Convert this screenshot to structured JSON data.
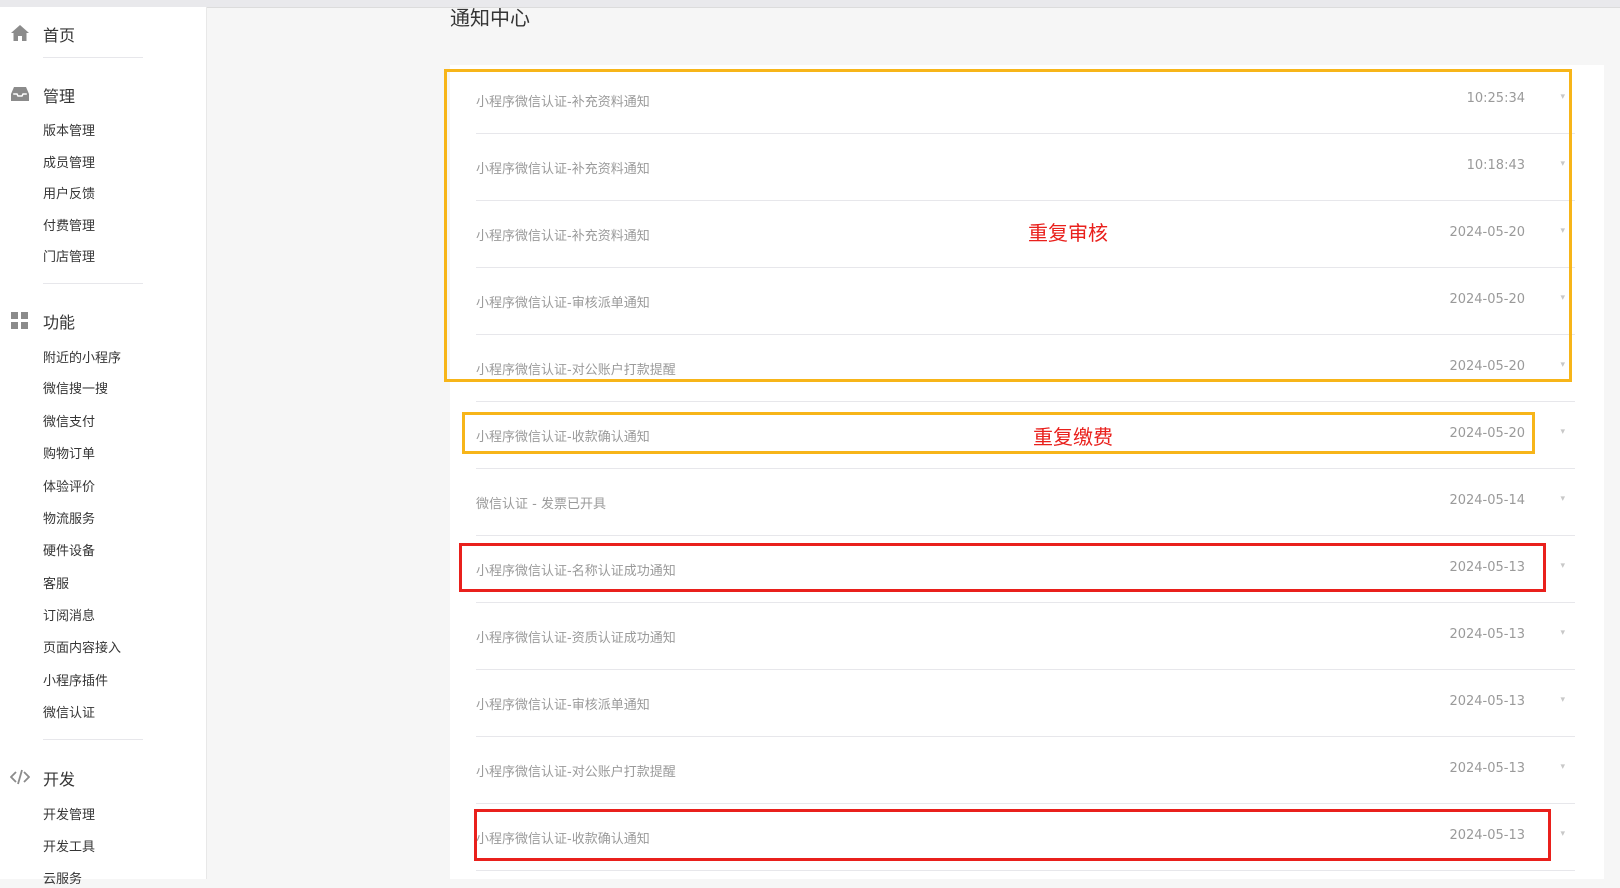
{
  "sidebar": {
    "home": {
      "label": "首页",
      "icon": "home-icon"
    },
    "manage": {
      "label": "管理",
      "icon": "inbox-icon",
      "items": [
        "版本管理",
        "成员管理",
        "用户反馈",
        "付费管理",
        "门店管理"
      ]
    },
    "features": {
      "label": "功能",
      "icon": "grid-icon",
      "items": [
        "附近的小程序",
        "微信搜一搜",
        "微信支付",
        "购物订单",
        "体验评价",
        "物流服务",
        "硬件设备",
        "客服",
        "订阅消息",
        "页面内容接入",
        "小程序插件",
        "微信认证"
      ]
    },
    "develop": {
      "label": "开发",
      "icon": "code-icon",
      "items": [
        "开发管理",
        "开发工具",
        "云服务"
      ]
    }
  },
  "main": {
    "title": "通知中心",
    "notifications": [
      {
        "title": "小程序微信认证-补充资料通知",
        "time": "10:25:34"
      },
      {
        "title": "小程序微信认证-补充资料通知",
        "time": "10:18:43"
      },
      {
        "title": "小程序微信认证-补充资料通知",
        "time": "2024-05-20"
      },
      {
        "title": "小程序微信认证-审核派单通知",
        "time": "2024-05-20"
      },
      {
        "title": "小程序微信认证-对公账户打款提醒",
        "time": "2024-05-20"
      },
      {
        "title": "小程序微信认证-收款确认通知",
        "time": "2024-05-20"
      },
      {
        "title": "微信认证 - 发票已开具",
        "time": "2024-05-14"
      },
      {
        "title": "小程序微信认证-名称认证成功通知",
        "time": "2024-05-13"
      },
      {
        "title": "小程序微信认证-资质认证成功通知",
        "time": "2024-05-13"
      },
      {
        "title": "小程序微信认证-审核派单通知",
        "time": "2024-05-13"
      },
      {
        "title": "小程序微信认证-对公账户打款提醒",
        "time": "2024-05-13"
      },
      {
        "title": "小程序微信认证-收款确认通知",
        "time": "2024-05-13"
      }
    ]
  },
  "annotations": {
    "repeat_review": "重复审核",
    "repeat_payment": "重复缴费",
    "colors": {
      "orange": "#f7b519",
      "red": "#e9201c"
    }
  }
}
